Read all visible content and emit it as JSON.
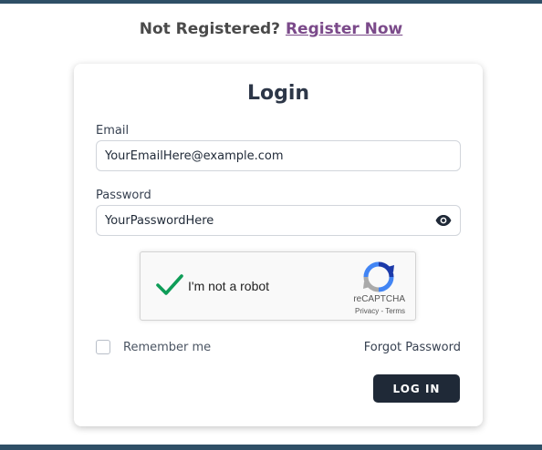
{
  "header": {
    "prompt_text": "Not Registered?",
    "register_link": "Register Now"
  },
  "login_card": {
    "title": "Login",
    "email": {
      "label": "Email",
      "value": "YourEmailHere@example.com"
    },
    "password": {
      "label": "Password",
      "value": "YourPasswordHere",
      "toggle_icon": "eye-icon"
    },
    "recaptcha": {
      "checkbox_label": "I'm not a robot",
      "checked": true,
      "brand": "reCAPTCHA",
      "links": "Privacy - Terms"
    },
    "remember_me": {
      "label": "Remember me",
      "checked": false
    },
    "forgot_password": "Forgot Password",
    "submit_label": "LOG IN"
  },
  "colors": {
    "top_bar": "#2e4f66",
    "link": "#7b4a8a",
    "button_bg": "#1f2937",
    "check": "#0f9d58"
  }
}
